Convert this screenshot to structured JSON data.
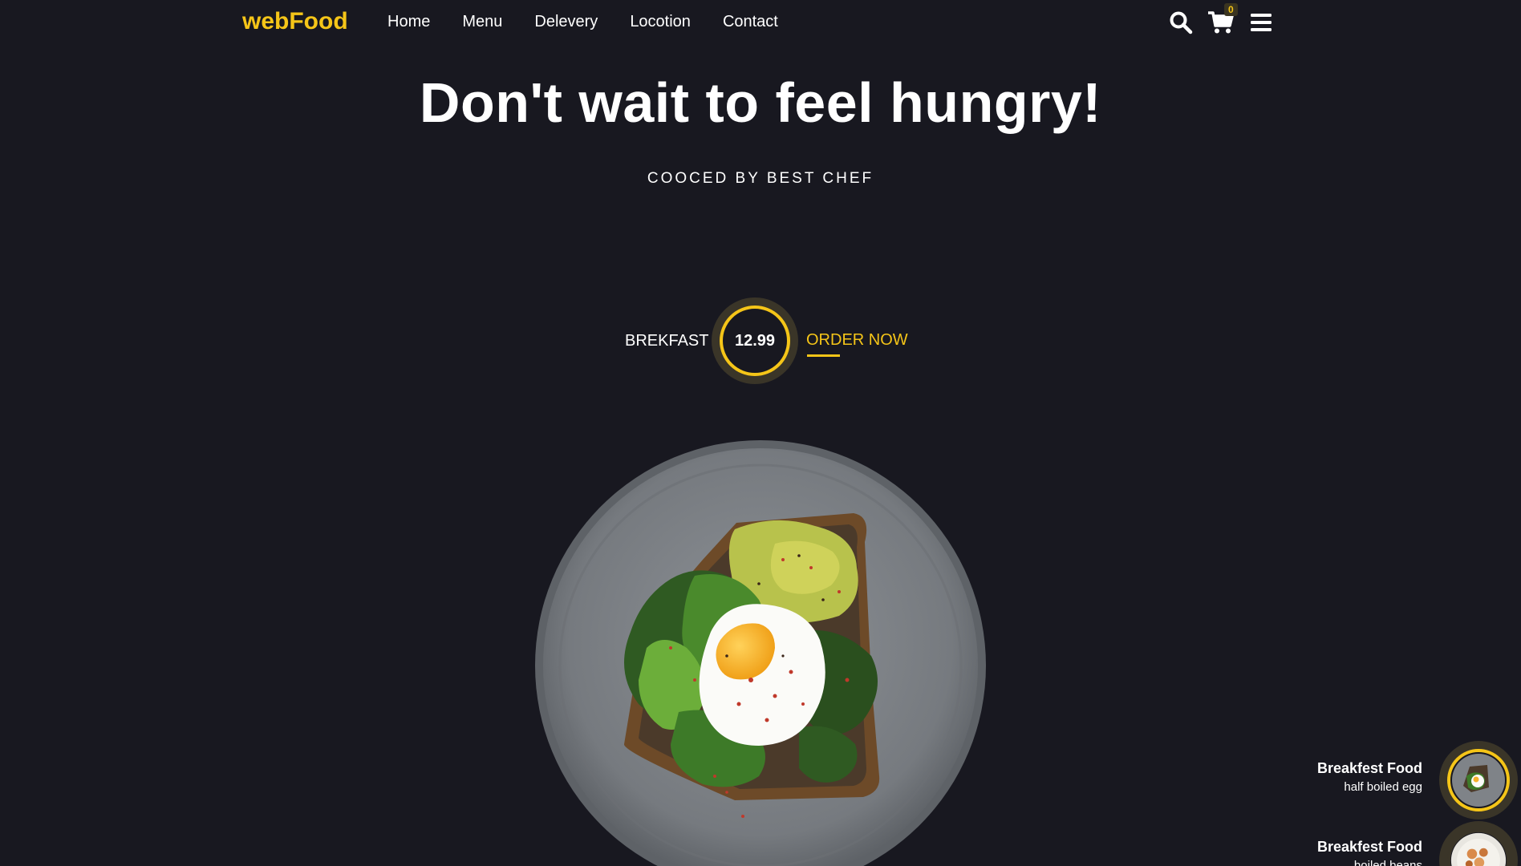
{
  "nav": {
    "logo": "webFood",
    "links": [
      "Home",
      "Menu",
      "Delevery",
      "Locotion",
      "Contact"
    ],
    "cart_count": "0",
    "icons": [
      "search-icon",
      "cart-icon",
      "menu-icon"
    ]
  },
  "hero": {
    "title": "Don't wait to feel hungry!",
    "subtitle": "COOCED BY BEST CHEF"
  },
  "offer": {
    "label": "BREKFAST",
    "price": "12.99",
    "cta": "ORDER NOW"
  },
  "thumbnails": [
    {
      "title": "Breakfest Food",
      "desc": "half boiled egg"
    },
    {
      "title": "Breakfest Food",
      "desc": "boiled beans"
    }
  ],
  "colors": {
    "background": "#181820",
    "accent": "#f5c518",
    "text": "#ffffff"
  }
}
